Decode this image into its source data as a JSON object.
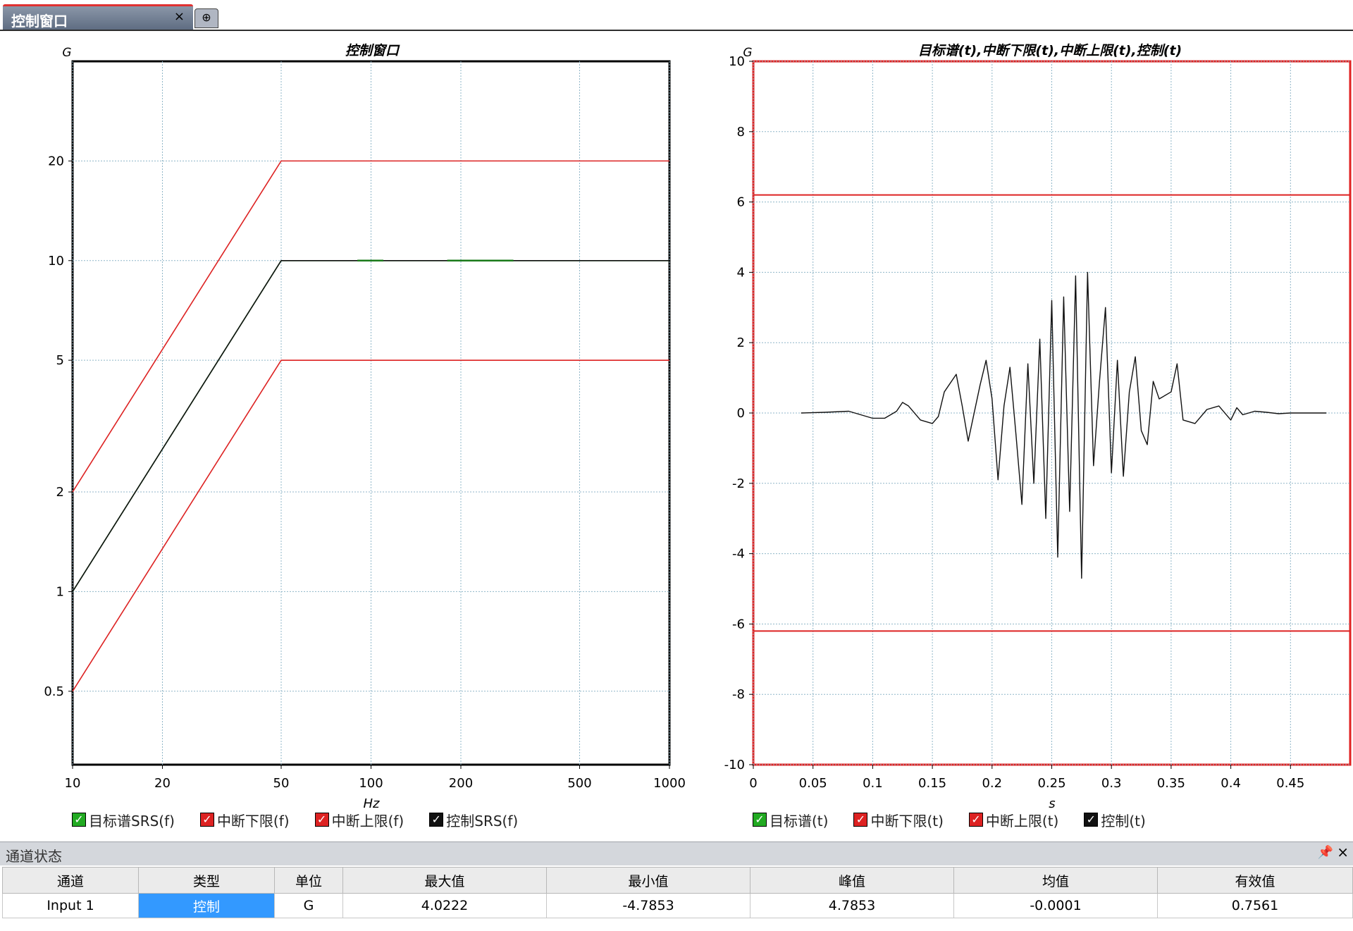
{
  "tabs": [
    {
      "label": "控制窗口",
      "close": "×"
    }
  ],
  "new_tab_icon": "add-tab-icon",
  "left_chart": {
    "title": "控制窗口",
    "y_unit": "G",
    "x_unit": "Hz",
    "x_ticks": [
      "10",
      "20",
      "50",
      "100",
      "200",
      "500",
      "1000"
    ],
    "y_ticks": [
      "20",
      "10",
      "5",
      "2",
      "1",
      "0.5"
    ],
    "legend": [
      {
        "label": "目标谱SRS(f)",
        "color": "#22aa22"
      },
      {
        "label": "中断下限(f)",
        "color": "#dd2222"
      },
      {
        "label": "中断上限(f)",
        "color": "#dd2222"
      },
      {
        "label": "控制SRS(f)",
        "color": "#111111"
      }
    ]
  },
  "right_chart": {
    "title": "目标谱(t),中断下限(t),中断上限(t),控制(t)",
    "y_unit": "G",
    "x_unit": "s",
    "x_ticks": [
      "0",
      "0.05",
      "0.1",
      "0.15",
      "0.2",
      "0.25",
      "0.3",
      "0.35",
      "0.4",
      "0.45"
    ],
    "y_ticks": [
      "10",
      "8",
      "6",
      "4",
      "2",
      "0",
      "-2",
      "-4",
      "-6",
      "-8",
      "-10"
    ],
    "legend": [
      {
        "label": "目标谱(t)",
        "color": "#22aa22"
      },
      {
        "label": "中断下限(t)",
        "color": "#dd2222"
      },
      {
        "label": "中断上限(t)",
        "color": "#dd2222"
      },
      {
        "label": "控制(t)",
        "color": "#111111"
      }
    ]
  },
  "chart_data": [
    {
      "type": "line",
      "title": "控制窗口",
      "xlabel": "Hz",
      "ylabel": "G",
      "xscale": "log",
      "yscale": "log",
      "xlim": [
        10,
        1000
      ],
      "ylim": [
        0.3,
        40
      ],
      "grid": true,
      "legend_position": "bottom",
      "series": [
        {
          "name": "目标谱SRS(f)",
          "color": "#22aa22",
          "x": [
            10,
            50,
            1000
          ],
          "y": [
            1,
            10,
            10
          ]
        },
        {
          "name": "中断下限(f)",
          "color": "#dd2222",
          "x": [
            10,
            50,
            1000
          ],
          "y": [
            0.5,
            5,
            5
          ]
        },
        {
          "name": "中断上限(f)",
          "color": "#dd2222",
          "x": [
            10,
            50,
            1000
          ],
          "y": [
            2,
            20,
            20
          ]
        },
        {
          "name": "控制SRS(f)",
          "color": "#111111",
          "x": [
            10,
            50,
            1000
          ],
          "y": [
            1,
            10,
            10
          ]
        }
      ]
    },
    {
      "type": "line",
      "title": "目标谱(t),中断下限(t),中断上限(t),控制(t)",
      "xlabel": "s",
      "ylabel": "G",
      "xlim": [
        0,
        0.5
      ],
      "ylim": [
        -10,
        10
      ],
      "grid": true,
      "legend_position": "bottom",
      "series": [
        {
          "name": "中断下限(t)",
          "color": "#dd2222",
          "x": [
            0,
            0.5
          ],
          "y": [
            -6.2,
            -6.2
          ]
        },
        {
          "name": "中断上限(t)",
          "color": "#dd2222",
          "x": [
            0,
            0.5
          ],
          "y": [
            6.2,
            6.2
          ]
        },
        {
          "name": "控制(t)",
          "color": "#111111",
          "x": [
            0.04,
            0.06,
            0.08,
            0.1,
            0.11,
            0.12,
            0.125,
            0.13,
            0.14,
            0.15,
            0.155,
            0.16,
            0.17,
            0.175,
            0.18,
            0.19,
            0.195,
            0.2,
            0.205,
            0.21,
            0.215,
            0.22,
            0.225,
            0.23,
            0.235,
            0.24,
            0.245,
            0.25,
            0.255,
            0.26,
            0.265,
            0.27,
            0.275,
            0.28,
            0.285,
            0.29,
            0.295,
            0.3,
            0.305,
            0.31,
            0.315,
            0.32,
            0.325,
            0.33,
            0.335,
            0.34,
            0.35,
            0.355,
            0.36,
            0.37,
            0.38,
            0.39,
            0.4,
            0.405,
            0.41,
            0.42,
            0.43,
            0.44,
            0.45,
            0.46,
            0.48
          ],
          "y": [
            0,
            0.02,
            0.05,
            -0.15,
            -0.15,
            0.05,
            0.3,
            0.2,
            -0.2,
            -0.3,
            -0.1,
            0.6,
            1.1,
            0.2,
            -0.8,
            0.8,
            1.5,
            0.4,
            -1.9,
            0.2,
            1.3,
            -0.6,
            -2.6,
            1.4,
            -2,
            2.1,
            -3,
            3.2,
            -4.1,
            3.3,
            -2.8,
            3.9,
            -4.7,
            4.0,
            -1.5,
            0.9,
            3.0,
            -1.7,
            1.5,
            -1.8,
            0.6,
            1.6,
            -0.5,
            -0.9,
            0.9,
            0.4,
            0.6,
            1.4,
            -0.2,
            -0.3,
            0.1,
            0.2,
            -0.2,
            0.15,
            -0.05,
            0.05,
            0.02,
            -0.02,
            0,
            0,
            0
          ]
        }
      ]
    }
  ],
  "status_panel": {
    "title": "通道状态",
    "pin_icon": "pin-icon",
    "close_label": "×",
    "columns": [
      "通道",
      "类型",
      "单位",
      "最大值",
      "最小值",
      "峰值",
      "均值",
      "有效值"
    ],
    "rows": [
      [
        "Input 1",
        "控制",
        "G",
        "4.0222",
        "-4.7853",
        "4.7853",
        "-0.0001",
        "0.7561"
      ]
    ]
  }
}
